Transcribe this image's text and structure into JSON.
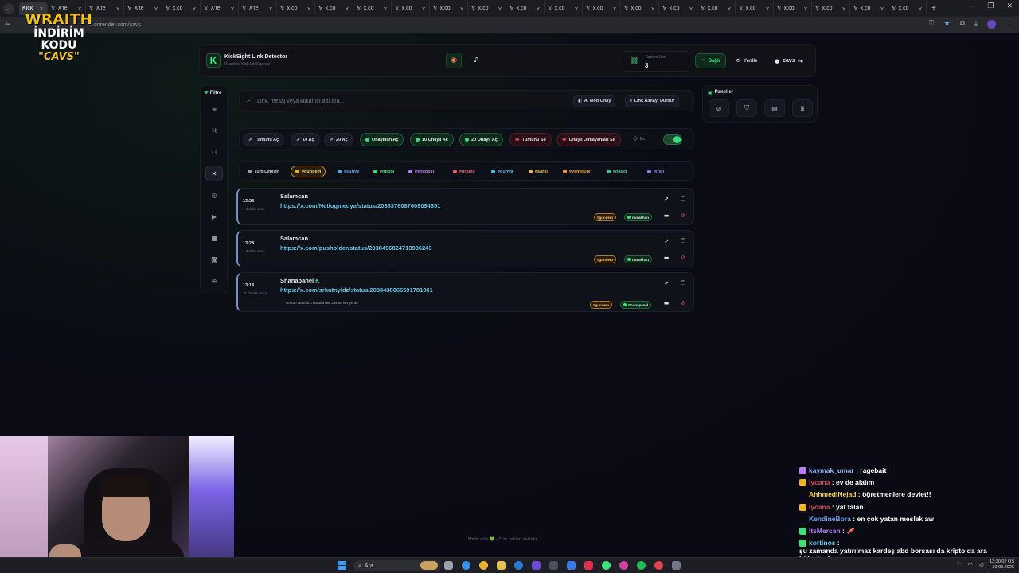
{
  "browser": {
    "tabs": [
      {
        "label": "Kick",
        "active": true
      },
      {
        "label": "X'te",
        "active": false
      },
      {
        "label": "X'te",
        "active": false
      },
      {
        "label": "X'te",
        "active": false
      },
      {
        "label": "x.co",
        "active": false
      },
      {
        "label": "X'te",
        "active": false
      },
      {
        "label": "X'te",
        "active": false
      },
      {
        "label": "x.co",
        "active": false
      },
      {
        "label": "x.co",
        "active": false
      },
      {
        "label": "x.co",
        "active": false
      },
      {
        "label": "x.co",
        "active": false
      },
      {
        "label": "x.co",
        "active": false
      },
      {
        "label": "x.co",
        "active": false
      },
      {
        "label": "x.co",
        "active": false
      },
      {
        "label": "x.co",
        "active": false
      },
      {
        "label": "x.co",
        "active": false
      },
      {
        "label": "x.co",
        "active": false
      },
      {
        "label": "x.co",
        "active": false
      },
      {
        "label": "x.co",
        "active": false
      },
      {
        "label": "x.co",
        "active": false
      },
      {
        "label": "x.co",
        "active": false
      },
      {
        "label": "x.co",
        "active": false
      },
      {
        "label": "x.co",
        "active": false
      },
      {
        "label": "x.co",
        "active": false
      }
    ],
    "url": "...onrender.com/cavs"
  },
  "promo": {
    "brand": "WRAITH",
    "line2": "İNDİRİM KODU",
    "line3": "\"CAVS\""
  },
  "header": {
    "title": "KickSight Link Detector",
    "subtitle": "Realtime Kick Intelligence",
    "stat_label": "Toplam Link",
    "stat_value": "3",
    "connected_label": "Bağlı",
    "refresh_label": "Yenile",
    "user_label": "cavs"
  },
  "sidebar": {
    "filter_label": "Filtre"
  },
  "search": {
    "placeholder": "Link, mesaj veya kullanıcı adı ara...",
    "ai_mod_label": "AI Mod Onay",
    "stop_label": "Link Almayı Durdur"
  },
  "panels": {
    "title": "Paneller"
  },
  "actions": {
    "open_all": "Tümünü Aç",
    "open_10": "10 Aç",
    "open_20": "20 Aç",
    "open_approved": "Onaylıları Aç",
    "open_10_approved": "10 Onaylı Aç",
    "open_20_approved": "20 Onaylı Aç",
    "delete_all": "Tümünü Sil",
    "delete_unapproved": "Onaylı Olmayanları Sil",
    "bot_label": "Bot",
    "bot_on": true
  },
  "tags": [
    {
      "label": "Tüm Linkler",
      "color": "#9aa0ac",
      "active": false
    },
    {
      "label": "#gundem",
      "color": "#f0b429",
      "active": true
    },
    {
      "label": "#suriye",
      "color": "#5aa8f0",
      "active": false
    },
    {
      "label": "#futbol",
      "color": "#3ee07a",
      "active": false
    },
    {
      "label": "#shitpost",
      "color": "#b67cf0",
      "active": false
    },
    {
      "label": "#drama",
      "color": "#f0606e",
      "active": false
    },
    {
      "label": "#dunya",
      "color": "#4fc3e8",
      "active": false
    },
    {
      "label": "#sarki",
      "color": "#f0c040",
      "active": false
    },
    {
      "label": "#yemeklik",
      "color": "#f0a040",
      "active": false
    },
    {
      "label": "#haber",
      "color": "#40d0a0",
      "active": false
    },
    {
      "label": "#iran",
      "color": "#a080f0",
      "active": false
    }
  ],
  "links": [
    {
      "time": "13:28",
      "ago": "1 dakika önce",
      "user": "Salamcan",
      "kick_badge": "",
      "url": "https://x.com/Netlogmedya/status/2038376087609094351",
      "message": "",
      "tag": "#gundem",
      "moderator": "nusakhan"
    },
    {
      "time": "13:28",
      "ago": "1 dakika önce",
      "user": "Salamcan",
      "kick_badge": "",
      "url": "https://x.com/pusholder/status/2038496824713986243",
      "message": "",
      "tag": "#gundem",
      "moderator": "nusakhan"
    },
    {
      "time": "13:14",
      "ago": "15 dakika önce",
      "user": "Shanapanel",
      "kick_badge": "K",
      "url": "https://x.com/srkntnyldz/status/2038438066591781061",
      "message": "serkan tanyıldızı burada her zaman her yerde",
      "tag": "#gundem",
      "moderator": "Shanapanel"
    }
  ],
  "footer": {
    "text": "Made with 💚 - Tüm hakları saklıdır"
  },
  "chat": [
    {
      "user": "kaymak_umar",
      "color": "#8ab4f8",
      "text": "ragebait",
      "badge": "#b67cf0"
    },
    {
      "user": "lycana",
      "color": "#e04060",
      "text": "ev de alalım",
      "badge": "#f0b429"
    },
    {
      "user": "AhhmediNejad",
      "color": "#f0d050",
      "text": "öğretmenlere devlet!!",
      "badge": ""
    },
    {
      "user": "lycana",
      "color": "#e04060",
      "text": "yat falan",
      "badge": "#f0b429"
    },
    {
      "user": "KendineBora",
      "color": "#6aa0f0",
      "text": "en çok yatan meslek aw",
      "badge": ""
    },
    {
      "user": "ItsMercan",
      "color": "#b080f0",
      "text": "🥓",
      "badge": "#3ee07a"
    },
    {
      "user": "kortinos",
      "color": "#5ac8e8",
      "text": "şu zamanda yatırılmaz kardeş abd borsası da kripto da ara bölgelerde",
      "badge": "#3ee07a"
    }
  ],
  "taskbar": {
    "search_label": "Ara",
    "time": "13:30:02 ÖS",
    "date": "30.03.2026"
  }
}
